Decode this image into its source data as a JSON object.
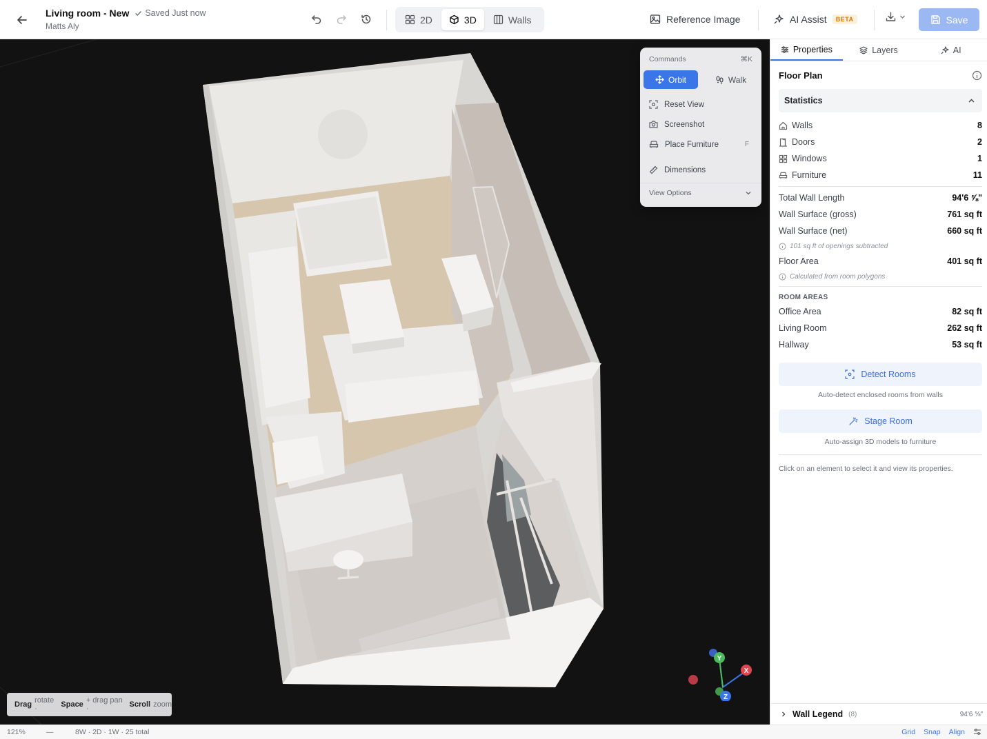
{
  "header": {
    "title": "Living room - New",
    "saved": "Saved Just now",
    "owner": "Matts Aly",
    "views": [
      {
        "label": "2D",
        "icon": "grid-icon",
        "active": false
      },
      {
        "label": "3D",
        "icon": "cube-icon",
        "active": true
      },
      {
        "label": "Walls",
        "icon": "walls-icon",
        "active": false
      }
    ],
    "reference_image": "Reference Image",
    "ai_assist": "AI Assist",
    "beta": "BETA",
    "save": "Save"
  },
  "commands": {
    "title": "Commands",
    "shortcut": "⌘K",
    "modes": [
      {
        "label": "Orbit",
        "active": true
      },
      {
        "label": "Walk",
        "active": false
      }
    ],
    "items": [
      {
        "label": "Reset View",
        "icon": "reset-view-icon",
        "key": ""
      },
      {
        "label": "Screenshot",
        "icon": "camera-icon",
        "key": ""
      },
      {
        "label": "Place Furniture",
        "icon": "sofa-icon",
        "key": "F"
      },
      {
        "label": "Dimensions",
        "icon": "ruler-icon",
        "key": ""
      }
    ],
    "view_options": "View Options"
  },
  "hint": {
    "drag": "Drag",
    "drag_action": "rotate ·",
    "space": "Space",
    "space_action": "+ drag pan ·",
    "scroll": "Scroll",
    "scroll_action": "zoom"
  },
  "gizmo": {
    "x": "X",
    "y": "Y",
    "z": "Z"
  },
  "panel": {
    "tabs": [
      {
        "label": "Properties",
        "active": true
      },
      {
        "label": "Layers",
        "active": false
      },
      {
        "label": "AI",
        "active": false
      }
    ],
    "floor_plan": "Floor Plan",
    "statistics": "Statistics",
    "counts": [
      {
        "label": "Walls",
        "value": "8",
        "icon": "home-icon"
      },
      {
        "label": "Doors",
        "value": "2",
        "icon": "door-icon"
      },
      {
        "label": "Windows",
        "value": "1",
        "icon": "window-icon"
      },
      {
        "label": "Furniture",
        "value": "11",
        "icon": "sofa-icon"
      }
    ],
    "metrics": [
      {
        "label": "Total Wall Length",
        "value": "94'6 ⅝\""
      },
      {
        "label": "Wall Surface (gross)",
        "value": "761 sq ft"
      },
      {
        "label": "Wall Surface (net)",
        "value": "660 sq ft"
      }
    ],
    "openings_note": "101 sq ft of openings subtracted",
    "floor_area_label": "Floor Area",
    "floor_area_value": "401 sq ft",
    "floor_area_note": "Calculated from room polygons",
    "room_areas_label": "ROOM AREAS",
    "rooms": [
      {
        "label": "Office Area",
        "value": "82 sq ft"
      },
      {
        "label": "Living Room",
        "value": "262 sq ft"
      },
      {
        "label": "Hallway",
        "value": "53 sq ft"
      }
    ],
    "detect_rooms": "Detect Rooms",
    "detect_caption": "Auto-detect enclosed rooms from walls",
    "stage_room": "Stage Room",
    "stage_caption": "Auto-assign 3D models to furniture",
    "select_hint": "Click on an element to select it and view its properties.",
    "wall_legend": "Wall Legend",
    "wall_legend_count": "(8)",
    "wall_legend_length": "94'6 ⅝\""
  },
  "status": {
    "zoom": "121%",
    "dash": "—",
    "counts": "8W · 2D · 1W · 25 total",
    "grid": "Grid",
    "snap": "Snap",
    "align": "Align"
  }
}
